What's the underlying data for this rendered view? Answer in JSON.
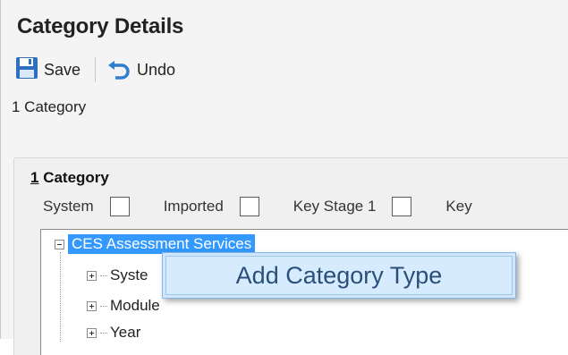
{
  "header": {
    "title": "Category Details"
  },
  "toolbar": {
    "save_label": "Save",
    "undo_label": "Undo",
    "save_icon": "floppy-disk-icon",
    "undo_icon": "undo-arrow-icon"
  },
  "breadcrumb": {
    "text": "1 Category"
  },
  "panel": {
    "title_number": "1",
    "title_text": " Category",
    "flags": [
      {
        "label": "System",
        "checked": false
      },
      {
        "label": "Imported",
        "checked": false
      },
      {
        "label": "Key Stage 1",
        "checked": false
      },
      {
        "label": "Key",
        "checked": false
      }
    ]
  },
  "tree": {
    "root": {
      "label": "CES Assessment Services",
      "expanded": true
    },
    "children": [
      {
        "label": "Syste",
        "expanded": false
      },
      {
        "label": "Module",
        "expanded": false
      },
      {
        "label": "Year",
        "expanded": false
      }
    ]
  },
  "context_menu": {
    "items": [
      {
        "label": "Add Category Type"
      }
    ]
  },
  "colors": {
    "selection": "#3399ff",
    "menu_bg": "#cfe6fb",
    "menu_text": "#2a4f7a"
  }
}
